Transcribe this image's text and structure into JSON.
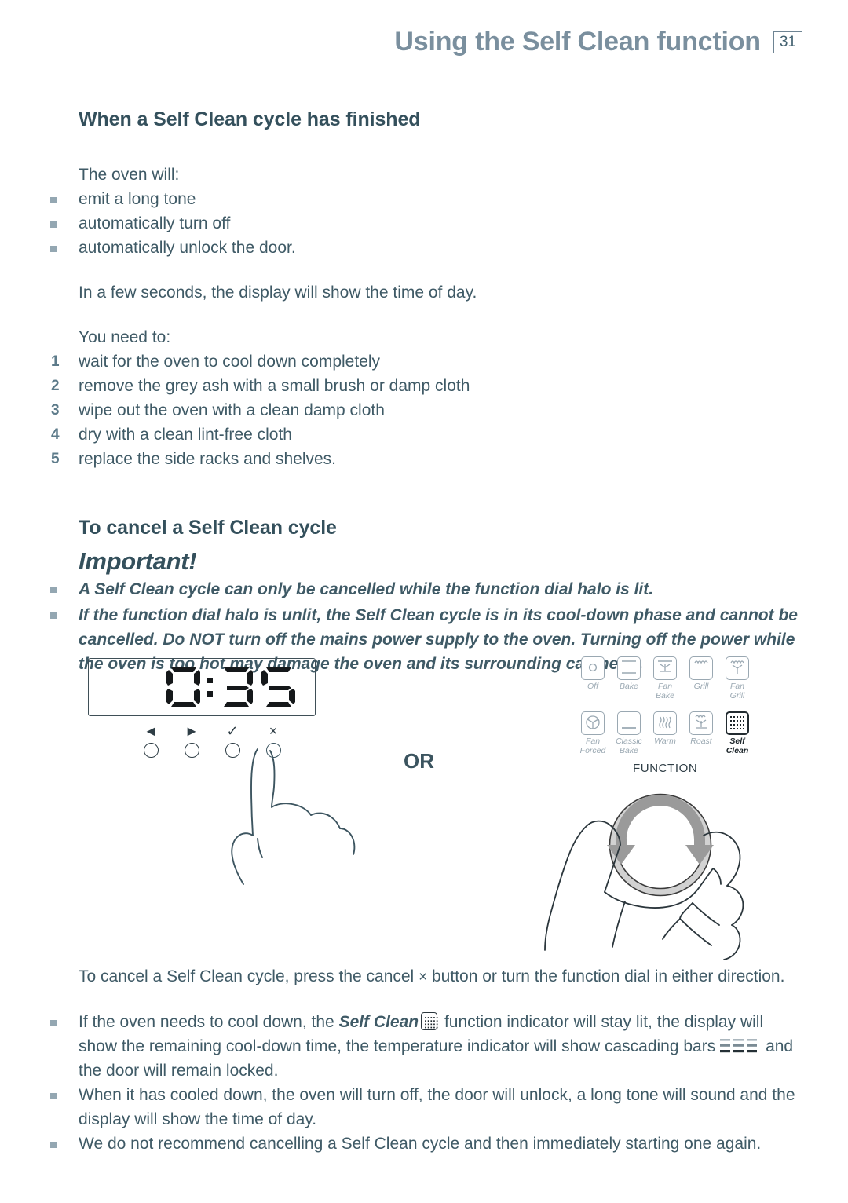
{
  "header": {
    "title": "Using the Self Clean function",
    "page_number": "31"
  },
  "sections": {
    "finished": {
      "heading": "When a Self Clean cycle has finished",
      "intro": "The oven will:",
      "bullets": [
        "emit a long tone",
        "automatically turn off",
        "automatically unlock the door."
      ],
      "note": "In a few seconds, the display will show the time of day.",
      "need_intro": "You need to:",
      "steps": [
        "wait for the oven to cool down completely",
        "remove the grey ash with a small brush or damp cloth",
        "wipe out the oven with a clean damp cloth",
        "dry with a clean lint-free cloth",
        "replace the side racks and shelves."
      ],
      "step_numbers": [
        "1",
        "2",
        "3",
        "4",
        "5"
      ]
    },
    "cancel": {
      "heading": "To cancel a Self Clean cycle",
      "important_title": "Important!",
      "important_bullets": [
        "A Self Clean cycle can only be cancelled while the function dial halo is lit.",
        "If the function dial halo is unlit, the Self Clean cycle is in its cool-down phase and cannot be cancelled. Do NOT turn off the mains power supply to the oven. Turning off the power while the oven is too hot may damage the oven and its surrounding cabinetry."
      ]
    }
  },
  "illustration": {
    "display_value": "0:35",
    "or_label": "OR",
    "function_label": "FUNCTION",
    "button_glyphs": [
      "◄",
      "►",
      "✓",
      "×"
    ],
    "button_names": [
      "back-button",
      "forward-button",
      "confirm-button",
      "cancel-button"
    ],
    "functions_row1": [
      {
        "label_line1": "Off",
        "label_line2": "",
        "icon": "off-icon",
        "active": false
      },
      {
        "label_line1": "Bake",
        "label_line2": "",
        "icon": "bake-icon",
        "active": false
      },
      {
        "label_line1": "Fan",
        "label_line2": "Bake",
        "icon": "fan-bake-icon",
        "active": false
      },
      {
        "label_line1": "Grill",
        "label_line2": "",
        "icon": "grill-icon",
        "active": false
      },
      {
        "label_line1": "Fan",
        "label_line2": "Grill",
        "icon": "fan-grill-icon",
        "active": false
      }
    ],
    "functions_row2": [
      {
        "label_line1": "Fan",
        "label_line2": "Forced",
        "icon": "fan-forced-icon",
        "active": false
      },
      {
        "label_line1": "Classic",
        "label_line2": "Bake",
        "icon": "classic-bake-icon",
        "active": false
      },
      {
        "label_line1": "Warm",
        "label_line2": "",
        "icon": "warm-icon",
        "active": false
      },
      {
        "label_line1": "Roast",
        "label_line2": "",
        "icon": "roast-icon",
        "active": false
      },
      {
        "label_line1": "Self",
        "label_line2": "Clean",
        "icon": "self-clean-icon",
        "active": true
      }
    ]
  },
  "bottom": {
    "cancel_sentence_a": "To cancel a Self Clean cycle, press the cancel ",
    "cancel_sentence_x": "×",
    "cancel_sentence_b": " button or turn the function dial in either direction.",
    "bullet1_a": "If the oven needs to cool down, the ",
    "bullet1_bold": "Self Clean",
    "bullet1_b": " function indicator will stay lit, the display will show the remaining cool-down time, the temperature indicator will show cascading bars",
    "bullet1_c": " and the door will remain locked.",
    "bullet2": "When it has cooled down, the oven will turn off, the door will unlock, a long tone will sound and the display will show the time of day.",
    "bullet3": "We do not recommend cancelling a Self Clean cycle and then immediately starting one again."
  },
  "colors": {
    "header": "#7a8f9e",
    "body_text": "#3f5a66",
    "heading": "#34505c",
    "bullet_square": "#94a7b2",
    "icon_grey": "#9aa8b2",
    "arrow_grey": "#9a9a9a",
    "halo_grey": "#d4d4d4"
  }
}
